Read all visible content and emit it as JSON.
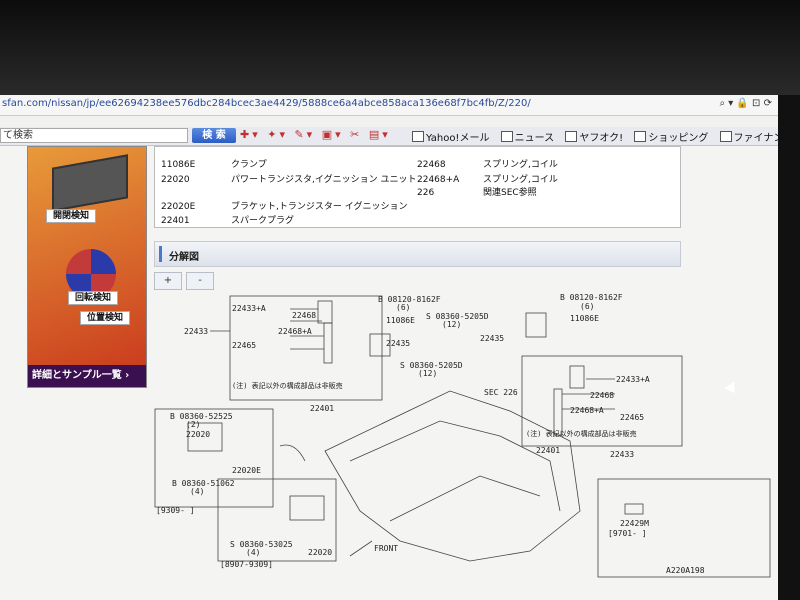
{
  "browser": {
    "url": "sfan.com/nissan/jp/ee62694238ee576dbc284bcec3ae4429/5888ce6a4abce858aca136e68f7bc4fb/Z/220/",
    "search_placeholder": "て検索",
    "search_button": "検 索",
    "links": [
      {
        "label": "Yahoo!メール",
        "icon": "mail-icon"
      },
      {
        "label": "ニュース",
        "icon": "news-icon"
      },
      {
        "label": "ヤフオク!",
        "icon": "auction-icon"
      },
      {
        "label": "ショッピング",
        "icon": "cart-icon"
      },
      {
        "label": "ファイナンス",
        "icon": "finance-icon"
      }
    ]
  },
  "ad": {
    "label_open": "開閉検知",
    "label_rotation": "回転検知",
    "label_position": "位置検知",
    "label_details": "詳細とサンプル一覧 ›"
  },
  "parts": {
    "left": [
      {
        "code": "11086E",
        "name": "クランプ"
      },
      {
        "code": "22020",
        "name": "パワートランジスタ,イグニッション ユニット"
      },
      {
        "code": "22020E",
        "name": "ブラケット,トランジスター イグニッション"
      },
      {
        "code": "22401",
        "name": "スパークプラグ"
      }
    ],
    "right": [
      {
        "code": "22468",
        "name": "スプリング,コイル"
      },
      {
        "code": "22468+A",
        "name": "スプリング,コイル"
      },
      {
        "code": "226",
        "name": "関連SEC参照"
      }
    ]
  },
  "section": {
    "title": "分解図"
  },
  "zoom": {
    "in": "+",
    "out": "-"
  },
  "diagram": {
    "left_group": {
      "c1": "22433+A",
      "c2": "22468",
      "c3": "22468+A",
      "c4": "22465",
      "c5": "22435",
      "c6": "11086E",
      "c7": "22433",
      "c8": "22401",
      "bolt1": "B 08120-8162F",
      "bolt1_qty": "(6)",
      "bolt2": "S 08360-5205D",
      "bolt2_qty": "(12)",
      "bolt3": "S 08360-5205D",
      "bolt3_qty": "(12)",
      "note": "(注) 表記以外の構成部品は非販売"
    },
    "right_group": {
      "bolt1": "B 08120-8162F",
      "bolt1_qty": "(6)",
      "c1": "11086E",
      "c2": "22435",
      "sec": "SEC 226",
      "c3": "22433+A",
      "c4": "22468",
      "c5": "22468+A",
      "c6": "22465",
      "note": "(注) 表記以外の構成部品は非販売",
      "c7": "22401",
      "c8": "22433"
    },
    "bracket_group": {
      "bolt1": "B 08360-52525",
      "bolt1_qty": "(2)",
      "c1": "22020",
      "c2": "22020E",
      "bolt2": "B 08360-51062",
      "bolt2_qty": "(4)",
      "period": "[9309-    ]"
    },
    "unit_group": {
      "bolt": "S 08360-53025",
      "bolt_qty": "(4)",
      "c1": "22020",
      "period": "[8907-9309]"
    },
    "front": "FRONT",
    "extra_part": "22429M",
    "extra_period": "[9701-    ]",
    "figure_code": "A220A198"
  }
}
